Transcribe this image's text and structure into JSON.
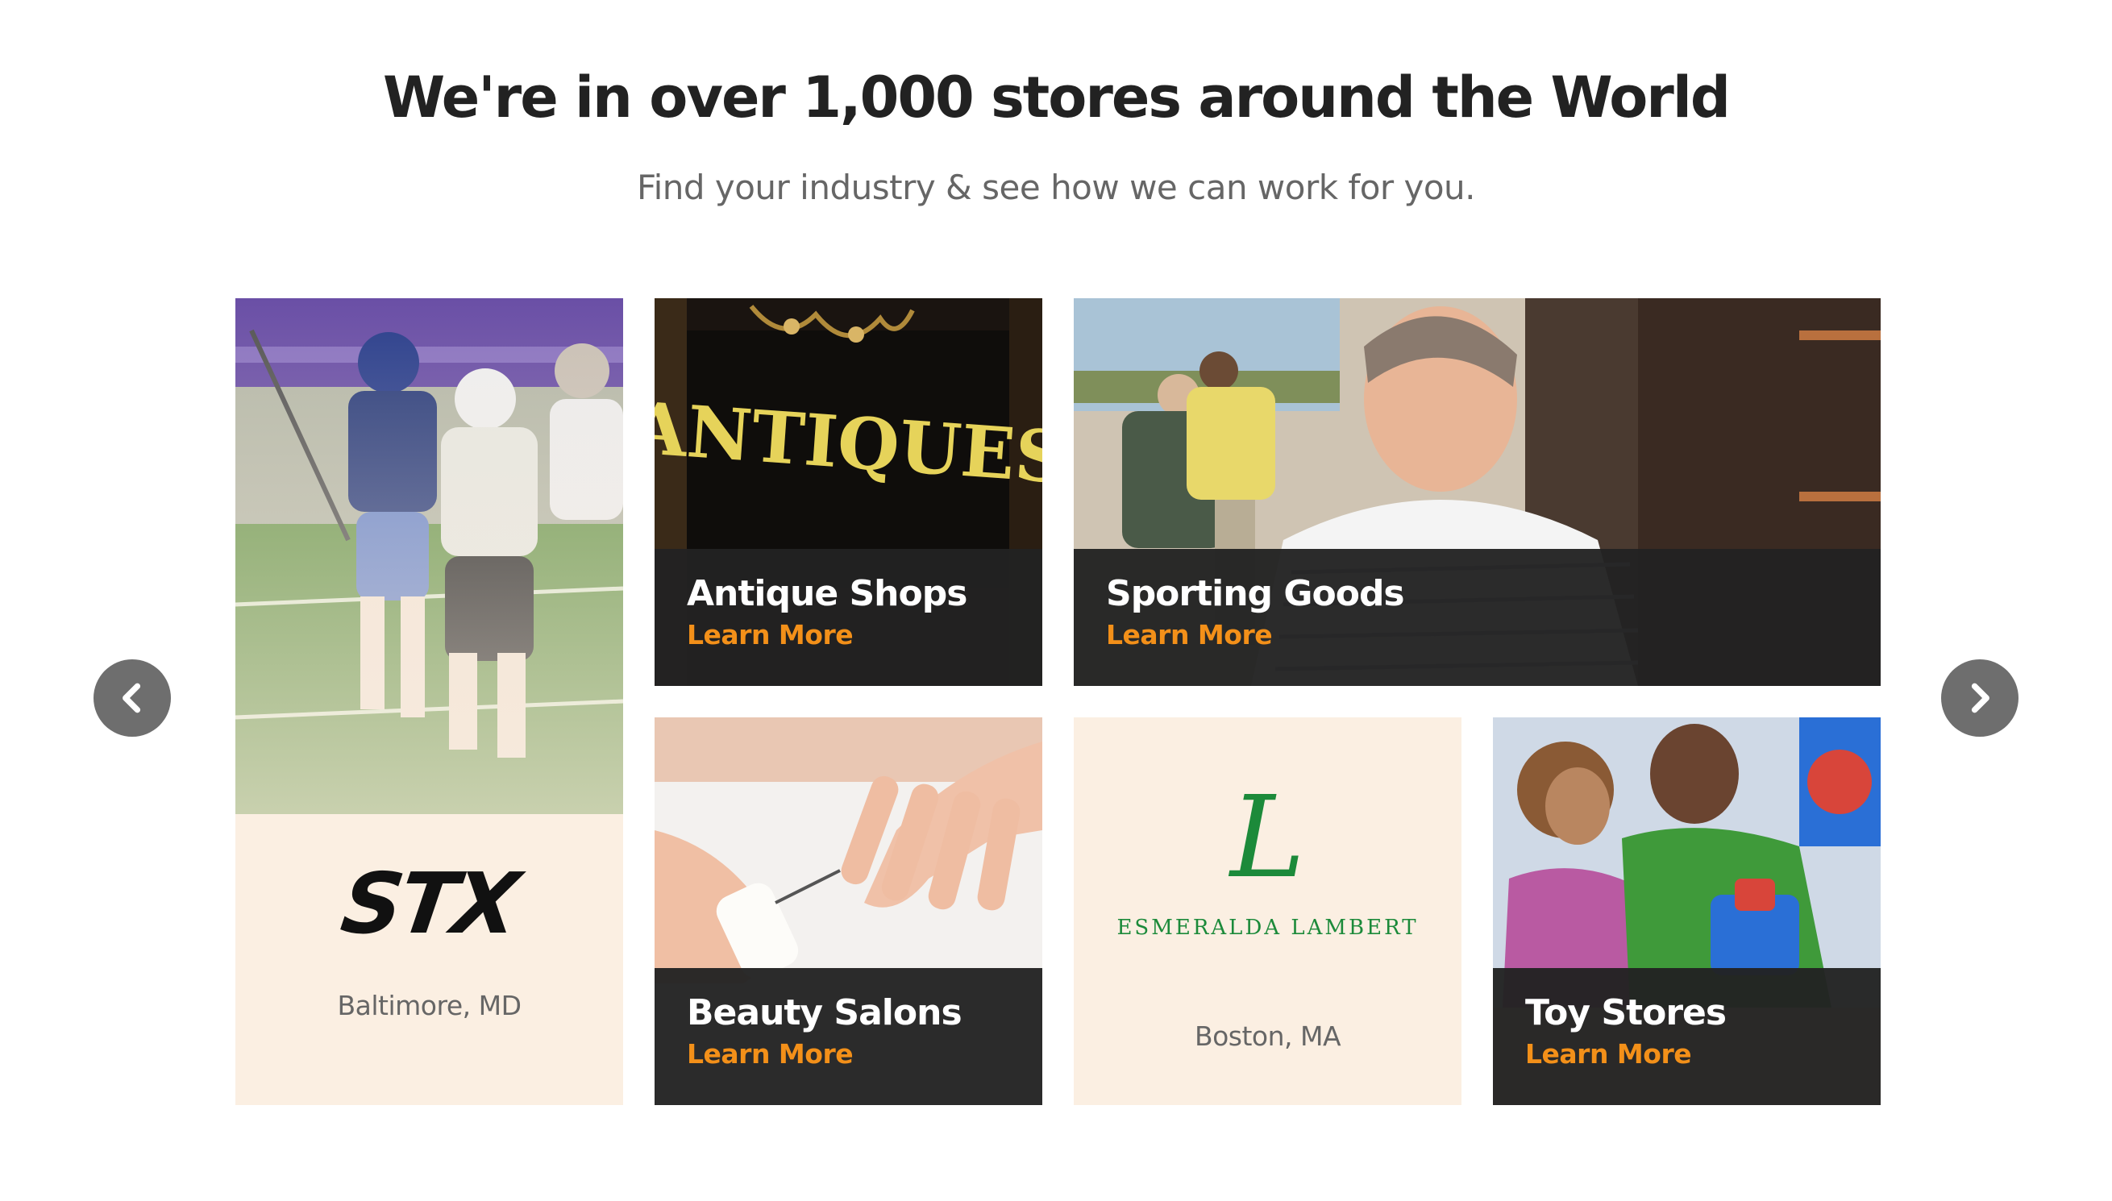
{
  "header": {
    "title": "We're in over 1,000 stores around the World",
    "subtitle": "Find your industry & see how we can work for you."
  },
  "carousel": {
    "prev_icon": "chevron-left-icon",
    "next_icon": "chevron-right-icon",
    "arrow_color": "#6e6e6e"
  },
  "tiles": {
    "stx": {
      "logo_text": "STX",
      "location": "Baltimore, MD"
    },
    "antique": {
      "title": "Antique Shops",
      "link": "Learn More",
      "sign_text": "ANTIQUES"
    },
    "sporting": {
      "title": "Sporting Goods",
      "link": "Learn More"
    },
    "beauty": {
      "title": "Beauty Salons",
      "link": "Learn More"
    },
    "esmeralda": {
      "logo_mark": "L",
      "logo_name": "ESMERALDA LAMBERT",
      "location": "Boston, MA"
    },
    "toys": {
      "title": "Toy Stores",
      "link": "Learn More"
    }
  },
  "colors": {
    "accent": "#f39019",
    "caption_bg": "#222222",
    "cream": "#fbefe2",
    "brand_green": "#1c8a3a"
  }
}
